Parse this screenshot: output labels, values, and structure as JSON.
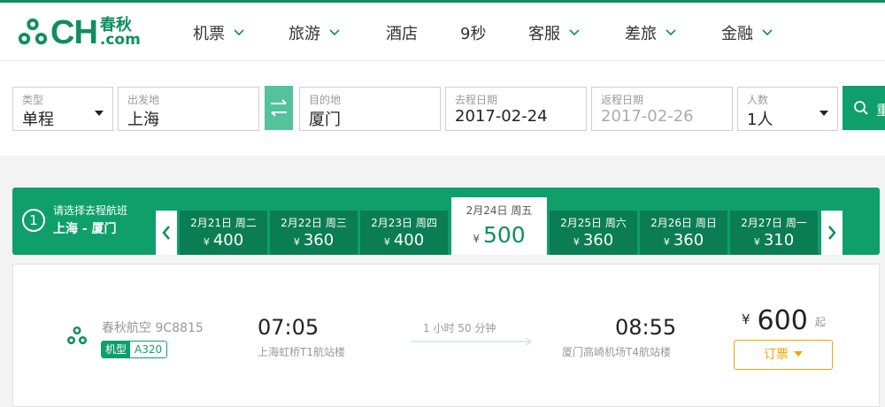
{
  "brand": {
    "name": "CH",
    "cn": "春秋",
    "domain": ".com",
    "color": "#0e8f5f"
  },
  "nav": [
    {
      "label": "机票",
      "dropdown": true
    },
    {
      "label": "旅游",
      "dropdown": true
    },
    {
      "label": "酒店",
      "dropdown": false
    },
    {
      "label": "9秒",
      "dropdown": false
    },
    {
      "label": "客服",
      "dropdown": true
    },
    {
      "label": "差旅",
      "dropdown": true
    },
    {
      "label": "金融",
      "dropdown": true
    }
  ],
  "search": {
    "type": {
      "label": "类型",
      "value": "单程"
    },
    "from": {
      "label": "出发地",
      "value": "上海"
    },
    "to": {
      "label": "目的地",
      "value": "厦门"
    },
    "depart": {
      "label": "去程日期",
      "value": "2017-02-24"
    },
    "return": {
      "label": "返程日期",
      "value": "2017-02-26"
    },
    "pax": {
      "label": "人数",
      "value": "1人"
    },
    "button_label": "重"
  },
  "date_bar": {
    "step": "1",
    "prompt": "请选择去程航班",
    "route": "上海 - 厦门",
    "currency": "¥",
    "dates": [
      {
        "date": "2月21日 周二",
        "price": "400"
      },
      {
        "date": "2月22日 周三",
        "price": "360"
      },
      {
        "date": "2月23日 周四",
        "price": "400"
      },
      {
        "date": "2月24日 周五",
        "price": "500",
        "selected": true
      },
      {
        "date": "2月25日 周六",
        "price": "360"
      },
      {
        "date": "2月26日 周日",
        "price": "360"
      },
      {
        "date": "2月27日 周一",
        "price": "310"
      }
    ]
  },
  "flight": {
    "airline": "春秋航空 9C8815",
    "plane_label": "机型",
    "plane": "A320",
    "depart_time": "07:05",
    "depart_airport": "上海虹桥T1航站楼",
    "duration": "1 小时 50 分钟",
    "arrive_time": "08:55",
    "arrive_airport": "厦门高崎机场T4航站楼",
    "currency": "¥",
    "price": "600",
    "price_suffix": "起",
    "book_label": "订票"
  }
}
